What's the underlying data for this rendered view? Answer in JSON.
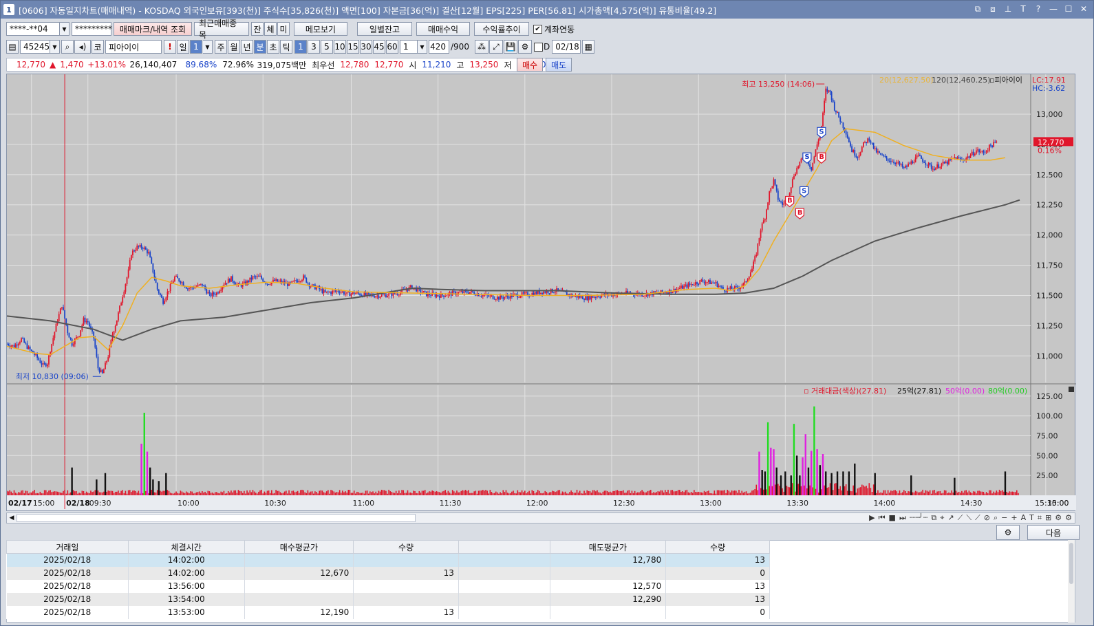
{
  "window": {
    "app_number": "1",
    "title": "[0606] 자동일지차트(매매내역) - KOSDAQ 외국인보유[393(천)] 주식수[35,826(천)] 액면[100] 자본금[36(억)] 결산[12월] EPS[225] PER[56.81] 시가총액[4,575(억)] 유통비율[49.2]",
    "controls": [
      "⧉",
      "⧈",
      "⊥",
      "T",
      "?",
      "—",
      "☐",
      "✕"
    ]
  },
  "toolbar1": {
    "account": "****-**04",
    "password": "*********",
    "btn_mark": "매매마크/내역 조회",
    "btn_recent": "최근매매종목",
    "btn_jan": "잔",
    "btn_che": "체",
    "btn_mi": "미",
    "btn_memo": "메모보기",
    "btn_daily": "일별잔고",
    "btn_profit": "매매수익",
    "btn_rate": "수익률추이",
    "link_label": "계좌연동"
  },
  "toolbar2": {
    "code": "452450",
    "market": "코",
    "stock_name": "피아이이",
    "period_buttons": [
      "일",
      "1",
      "주",
      "월",
      "년",
      "분",
      "초",
      "틱"
    ],
    "interval_buttons": [
      "1",
      "3",
      "5",
      "10",
      "15",
      "30",
      "45",
      "60"
    ],
    "count_value": "1",
    "bars_value": "420",
    "bars_total": "/900",
    "d_label": "D",
    "date_value": "02/18"
  },
  "infobar": {
    "price": "12,770",
    "change": "1,470",
    "change_pct": "+13.01%",
    "volume": "26,140,407",
    "pct1": "89.68%",
    "pct2": "72.96%",
    "amount": "319,075백만",
    "best_label": "최우선",
    "best_ask": "12,780",
    "best_bid": "12,770",
    "open_label": "시",
    "open": "11,210",
    "high_label": "고",
    "high": "13,250",
    "low_label": "저",
    "low": "10,830",
    "buy_btn": "매수",
    "sell_btn": "매도"
  },
  "chart_data": [
    {
      "type": "candlestick",
      "title": "피아이이",
      "legend": [
        "20(12,627.50)",
        "120(12,460.25)",
        "피아이이"
      ],
      "lc_label": "LC:17.91",
      "hc_label": "HC:-3.62",
      "current_price_label": "12,770",
      "current_pct_label": "0.16%",
      "high_annotation": "최고 13,250 (14:06)",
      "low_annotation": "최저 10,830 (09:06)",
      "y_ticks": [
        "13,000",
        "12,750",
        "12,500",
        "12,250",
        "12,000",
        "11,750",
        "11,500",
        "11,250",
        "11,000"
      ],
      "ylim": [
        10780,
        13330
      ],
      "date_labels": [
        "02/17",
        "02/18"
      ],
      "x_ticks": [
        "15:00",
        "09:30",
        "10:00",
        "10:30",
        "11:00",
        "11:30",
        "12:00",
        "12:30",
        "13:00",
        "13:30",
        "14:00",
        "14:30",
        "15:00",
        "15:30:00"
      ],
      "price_path": [
        [
          0,
          11100
        ],
        [
          5,
          11080
        ],
        [
          10,
          11140
        ],
        [
          15,
          11060
        ],
        [
          20,
          11000
        ],
        [
          25,
          10920
        ],
        [
          28,
          10940
        ],
        [
          30,
          11050
        ],
        [
          35,
          11300
        ],
        [
          38,
          11420
        ],
        [
          42,
          11200
        ],
        [
          45,
          11100
        ],
        [
          50,
          11180
        ],
        [
          53,
          11300
        ],
        [
          56,
          11280
        ],
        [
          60,
          11150
        ],
        [
          63,
          10900
        ],
        [
          66,
          10850
        ],
        [
          70,
          11000
        ],
        [
          73,
          11180
        ],
        [
          76,
          11300
        ],
        [
          80,
          11500
        ],
        [
          84,
          11700
        ],
        [
          86,
          11850
        ],
        [
          90,
          11900
        ],
        [
          94,
          11900
        ],
        [
          98,
          11850
        ],
        [
          102,
          11650
        ],
        [
          104,
          11550
        ],
        [
          108,
          11450
        ],
        [
          112,
          11550
        ],
        [
          116,
          11650
        ],
        [
          120,
          11620
        ],
        [
          125,
          11560
        ],
        [
          130,
          11570
        ],
        [
          135,
          11590
        ],
        [
          140,
          11500
        ],
        [
          145,
          11520
        ],
        [
          150,
          11600
        ],
        [
          155,
          11640
        ],
        [
          160,
          11580
        ],
        [
          165,
          11600
        ],
        [
          170,
          11650
        ],
        [
          175,
          11650
        ],
        [
          180,
          11600
        ],
        [
          185,
          11620
        ],
        [
          190,
          11610
        ],
        [
          195,
          11590
        ],
        [
          200,
          11620
        ],
        [
          205,
          11650
        ],
        [
          210,
          11580
        ],
        [
          215,
          11560
        ],
        [
          220,
          11520
        ],
        [
          225,
          11530
        ],
        [
          230,
          11540
        ],
        [
          235,
          11510
        ],
        [
          240,
          11520
        ],
        [
          250,
          11500
        ],
        [
          260,
          11500
        ],
        [
          270,
          11520
        ],
        [
          280,
          11570
        ],
        [
          290,
          11510
        ],
        [
          300,
          11500
        ],
        [
          310,
          11520
        ],
        [
          320,
          11530
        ],
        [
          330,
          11500
        ],
        [
          340,
          11480
        ],
        [
          350,
          11500
        ],
        [
          360,
          11510
        ],
        [
          370,
          11530
        ],
        [
          380,
          11540
        ],
        [
          390,
          11500
        ],
        [
          400,
          11480
        ],
        [
          410,
          11500
        ],
        [
          420,
          11510
        ],
        [
          430,
          11520
        ],
        [
          440,
          11510
        ],
        [
          450,
          11520
        ],
        [
          460,
          11540
        ],
        [
          470,
          11580
        ],
        [
          480,
          11620
        ],
        [
          490,
          11600
        ],
        [
          495,
          11550
        ],
        [
          505,
          11560
        ],
        [
          510,
          11600
        ],
        [
          515,
          11720
        ],
        [
          518,
          11850
        ],
        [
          521,
          12050
        ],
        [
          524,
          12150
        ],
        [
          527,
          12350
        ],
        [
          530,
          12450
        ],
        [
          533,
          12300
        ],
        [
          536,
          12250
        ],
        [
          540,
          12320
        ],
        [
          544,
          12500
        ],
        [
          548,
          12600
        ],
        [
          552,
          12650
        ],
        [
          556,
          12550
        ],
        [
          560,
          12750
        ],
        [
          563,
          12900
        ],
        [
          566,
          13200
        ],
        [
          569,
          13180
        ],
        [
          572,
          13050
        ],
        [
          576,
          12950
        ],
        [
          580,
          12850
        ],
        [
          584,
          12700
        ],
        [
          588,
          12650
        ],
        [
          592,
          12750
        ],
        [
          596,
          12800
        ],
        [
          600,
          12700
        ],
        [
          605,
          12650
        ],
        [
          610,
          12620
        ],
        [
          615,
          12600
        ],
        [
          620,
          12550
        ],
        [
          625,
          12600
        ],
        [
          630,
          12650
        ],
        [
          635,
          12600
        ],
        [
          640,
          12550
        ],
        [
          645,
          12580
        ],
        [
          650,
          12600
        ],
        [
          655,
          12640
        ],
        [
          660,
          12620
        ],
        [
          665,
          12650
        ],
        [
          670,
          12700
        ],
        [
          675,
          12680
        ],
        [
          680,
          12740
        ],
        [
          685,
          12770
        ]
      ],
      "ma20_path": [
        [
          0,
          11080
        ],
        [
          20,
          11020
        ],
        [
          30,
          11010
        ],
        [
          40,
          11080
        ],
        [
          50,
          11150
        ],
        [
          60,
          11160
        ],
        [
          70,
          11050
        ],
        [
          80,
          11250
        ],
        [
          90,
          11520
        ],
        [
          100,
          11650
        ],
        [
          110,
          11620
        ],
        [
          120,
          11580
        ],
        [
          140,
          11560
        ],
        [
          160,
          11590
        ],
        [
          180,
          11610
        ],
        [
          200,
          11600
        ],
        [
          220,
          11560
        ],
        [
          240,
          11530
        ],
        [
          280,
          11520
        ],
        [
          320,
          11510
        ],
        [
          360,
          11500
        ],
        [
          400,
          11500
        ],
        [
          440,
          11510
        ],
        [
          470,
          11550
        ],
        [
          490,
          11560
        ],
        [
          500,
          11540
        ],
        [
          510,
          11580
        ],
        [
          520,
          11720
        ],
        [
          530,
          11950
        ],
        [
          540,
          12150
        ],
        [
          550,
          12350
        ],
        [
          560,
          12550
        ],
        [
          570,
          12780
        ],
        [
          580,
          12880
        ],
        [
          600,
          12850
        ],
        [
          620,
          12740
        ],
        [
          640,
          12660
        ],
        [
          660,
          12620
        ],
        [
          680,
          12620
        ],
        [
          690,
          12640
        ]
      ],
      "ma120_path": [
        [
          0,
          11330
        ],
        [
          30,
          11290
        ],
        [
          60,
          11220
        ],
        [
          80,
          11130
        ],
        [
          100,
          11220
        ],
        [
          120,
          11290
        ],
        [
          150,
          11320
        ],
        [
          180,
          11380
        ],
        [
          210,
          11440
        ],
        [
          240,
          11480
        ],
        [
          260,
          11520
        ],
        [
          280,
          11560
        ],
        [
          300,
          11550
        ],
        [
          330,
          11540
        ],
        [
          380,
          11540
        ],
        [
          420,
          11520
        ],
        [
          460,
          11510
        ],
        [
          490,
          11510
        ],
        [
          510,
          11520
        ],
        [
          530,
          11560
        ],
        [
          550,
          11660
        ],
        [
          570,
          11790
        ],
        [
          600,
          11950
        ],
        [
          630,
          12060
        ],
        [
          660,
          12160
        ],
        [
          690,
          12250
        ],
        [
          700,
          12290
        ]
      ],
      "trade_marks": [
        {
          "label": "B",
          "t": 541,
          "price": 12280
        },
        {
          "label": "B",
          "t": 548,
          "price": 12180
        },
        {
          "label": "S",
          "t": 551,
          "price": 12360
        },
        {
          "label": "S",
          "t": 553,
          "price": 12640
        },
        {
          "label": "B",
          "t": 563,
          "price": 12640
        },
        {
          "label": "S",
          "t": 563,
          "price": 12850
        }
      ]
    },
    {
      "type": "bar",
      "title": "거래대금(색상)(27.81)",
      "legend": [
        "거래대금(색상)(27.81)",
        "25억(27.81)",
        "50억(0.00)",
        "80억(0.00)"
      ],
      "y_ticks": [
        "125.00",
        "100.00",
        "75.00",
        "50.00",
        "25.00"
      ],
      "ylim": [
        0,
        130
      ],
      "spikes": [
        {
          "t": 45,
          "v": 35,
          "c": "black"
        },
        {
          "t": 62,
          "v": 20,
          "c": "black"
        },
        {
          "t": 68,
          "v": 28,
          "c": "black"
        },
        {
          "t": 93,
          "v": 65,
          "c": "magenta"
        },
        {
          "t": 95,
          "v": 104,
          "c": "lime"
        },
        {
          "t": 97,
          "v": 55,
          "c": "magenta"
        },
        {
          "t": 99,
          "v": 35,
          "c": "black"
        },
        {
          "t": 101,
          "v": 20,
          "c": "black"
        },
        {
          "t": 105,
          "v": 18,
          "c": "black"
        },
        {
          "t": 110,
          "v": 28,
          "c": "black"
        },
        {
          "t": 520,
          "v": 55,
          "c": "magenta"
        },
        {
          "t": 522,
          "v": 32,
          "c": "black"
        },
        {
          "t": 524,
          "v": 30,
          "c": "black"
        },
        {
          "t": 526,
          "v": 92,
          "c": "lime"
        },
        {
          "t": 528,
          "v": 60,
          "c": "magenta"
        },
        {
          "t": 530,
          "v": 58,
          "c": "magenta"
        },
        {
          "t": 532,
          "v": 35,
          "c": "black"
        },
        {
          "t": 535,
          "v": 25,
          "c": "black"
        },
        {
          "t": 538,
          "v": 30,
          "c": "black"
        },
        {
          "t": 542,
          "v": 25,
          "c": "black"
        },
        {
          "t": 544,
          "v": 90,
          "c": "lime"
        },
        {
          "t": 546,
          "v": 50,
          "c": "black"
        },
        {
          "t": 548,
          "v": 25,
          "c": "black"
        },
        {
          "t": 550,
          "v": 48,
          "c": "magenta"
        },
        {
          "t": 552,
          "v": 77,
          "c": "magenta"
        },
        {
          "t": 554,
          "v": 35,
          "c": "black"
        },
        {
          "t": 556,
          "v": 56,
          "c": "magenta"
        },
        {
          "t": 558,
          "v": 112,
          "c": "lime"
        },
        {
          "t": 560,
          "v": 58,
          "c": "magenta"
        },
        {
          "t": 562,
          "v": 38,
          "c": "black"
        },
        {
          "t": 564,
          "v": 52,
          "c": "magenta"
        },
        {
          "t": 566,
          "v": 30,
          "c": "black"
        },
        {
          "t": 570,
          "v": 28,
          "c": "black"
        },
        {
          "t": 574,
          "v": 30,
          "c": "black"
        },
        {
          "t": 578,
          "v": 30,
          "c": "black"
        },
        {
          "t": 582,
          "v": 30,
          "c": "black"
        },
        {
          "t": 586,
          "v": 40,
          "c": "black"
        },
        {
          "t": 600,
          "v": 28,
          "c": "black"
        },
        {
          "t": 625,
          "v": 25,
          "c": "black"
        },
        {
          "t": 655,
          "v": 22,
          "c": "black"
        },
        {
          "t": 690,
          "v": 30,
          "c": "black"
        }
      ]
    }
  ],
  "scrollbar_tools": [
    "▶",
    "⏮",
    "■",
    "⏭",
    "┄┄╯┄",
    "⧉",
    "⌖",
    "↗",
    "⟋",
    "⟍",
    "⟋",
    "⊘",
    "⌕",
    "−",
    "+",
    "A",
    "T",
    "⌗",
    "⊞",
    "⚙",
    "⚙"
  ],
  "bottom": {
    "settings_btn": "⚙",
    "next_btn": "다음"
  },
  "trade_table": {
    "headers": [
      "거래일",
      "체결시간",
      "매수평균가",
      "수량",
      "",
      "매도평균가",
      "수량"
    ],
    "rows": [
      [
        "2025/02/18",
        "14:02:00",
        "",
        "",
        "",
        "12,780",
        "13"
      ],
      [
        "2025/02/18",
        "14:02:00",
        "12,670",
        "13",
        "",
        "",
        "0"
      ],
      [
        "2025/02/18",
        "13:56:00",
        "",
        "",
        "",
        "12,570",
        "13"
      ],
      [
        "2025/02/18",
        "13:54:00",
        "",
        "",
        "",
        "12,290",
        "13"
      ],
      [
        "2025/02/18",
        "13:53:00",
        "12,190",
        "13",
        "",
        "",
        "0"
      ]
    ]
  },
  "colors": {
    "up": "#e0162b",
    "down": "#1a44c9",
    "ma20": "#f0b020",
    "ma120": "#555555",
    "chart_bg": "#c6c6c6",
    "grid": "#e3e3e3"
  }
}
